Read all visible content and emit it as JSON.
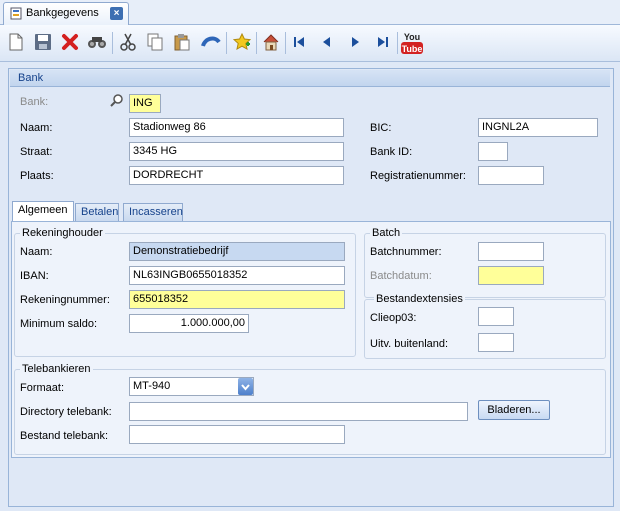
{
  "window": {
    "tab_title": "Bankgegevens"
  },
  "toolbar": {
    "buttons": [
      "new-icon",
      "save-icon",
      "delete-icon",
      "find-icon",
      "cut-icon",
      "copy-icon",
      "paste-icon",
      "undo-icon",
      "favorite-icon",
      "home-icon",
      "first-icon",
      "previous-icon",
      "next-icon",
      "last-icon",
      "youtube-icon"
    ],
    "youtube_text_top": "You",
    "youtube_text_bottom": "Tube"
  },
  "bank": {
    "group_title": "Bank",
    "bank_label": "Bank:",
    "bank_value": "ING",
    "naam_label": "Naam:",
    "naam_value": "Stadionweg 86",
    "straat_label": "Straat:",
    "straat_value": "3345 HG",
    "plaats_label": "Plaats:",
    "plaats_value": "DORDRECHT",
    "bic_label": "BIC:",
    "bic_value": "INGNL2A",
    "bankid_label": "Bank ID:",
    "bankid_value": "",
    "regnr_label": "Registratienummer:",
    "regnr_value": ""
  },
  "tabs": [
    "Algemeen",
    "Betalen",
    "Incasseren"
  ],
  "rekeninghouder": {
    "title": "Rekeninghouder",
    "naam_label": "Naam:",
    "naam_value": "Demonstratiebedrijf",
    "iban_label": "IBAN:",
    "iban_value": "NL63INGB0655018352",
    "rekeningnummer_label": "Rekeningnummer:",
    "rekeningnummer_value": "655018352",
    "minsaldo_label": "Minimum saldo:",
    "minsaldo_value": "1.000.000,00"
  },
  "batch": {
    "title": "Batch",
    "batchnummer_label": "Batchnummer:",
    "batchnummer_value": "",
    "batchdatum_label": "Batchdatum:",
    "batchdatum_value": ""
  },
  "bestandextensies": {
    "title": "Bestandextensies",
    "clieop_label": "Clieop03:",
    "clieop_value": "",
    "uitv_label": "Uitv. buitenland:",
    "uitv_value": ""
  },
  "telebankieren": {
    "title": "Telebankieren",
    "formaat_label": "Formaat:",
    "formaat_value": "MT-940",
    "dir_label": "Directory telebank:",
    "dir_value": "",
    "bladeren_label": "Bladeren...",
    "bestand_label": "Bestand telebank:",
    "bestand_value": ""
  }
}
